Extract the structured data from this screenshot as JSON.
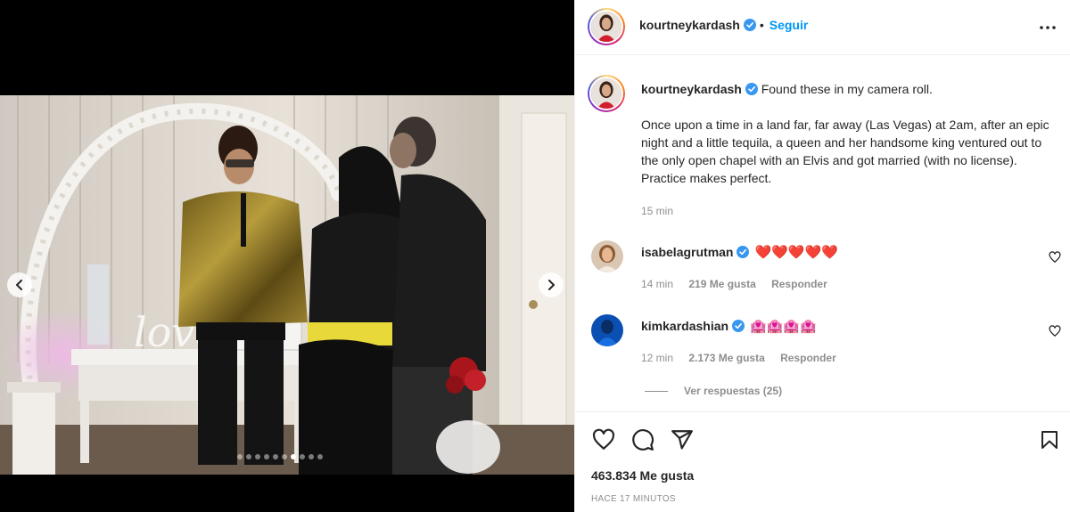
{
  "post": {
    "author": "kourtneykardash",
    "follow_label": "Seguir",
    "follow_separator": "•",
    "caption_lead": "Found these in my camera roll.",
    "caption_body": "Once upon a time in a land far, far away (Las Vegas) at 2am, after an epic night and a little tequila, a queen and her handsome king ventured out to the only open chapel with an Elvis and got married (with no license). Practice makes perfect.",
    "caption_time": "15 min",
    "likes": "463.834 Me gusta",
    "posted_ago": "HACE 17 MINUTOS"
  },
  "media": {
    "carousel_dots": 10,
    "active_dot": 6,
    "photo_sign_text": "love"
  },
  "comments": [
    {
      "user": "isabelagrutman",
      "text": "❤️❤️❤️❤️❤️",
      "time": "14 min",
      "likes": "219 Me gusta",
      "reply_label": "Responder"
    },
    {
      "user": "kimkardashian",
      "text": "🏩🏩🏩🏩",
      "time": "12 min",
      "likes": "2.173 Me gusta",
      "reply_label": "Responder"
    }
  ],
  "view_replies": "Ver respuestas (25)",
  "icons": {
    "verified": "verified-badge-icon",
    "more": "more-options-icon",
    "like": "heart-icon",
    "comment": "comment-icon",
    "share": "share-icon",
    "save": "bookmark-icon",
    "prev": "chevron-left-icon",
    "next": "chevron-right-icon"
  },
  "colors": {
    "accent": "#0095f6",
    "text": "#262626",
    "muted": "#8e8e8e",
    "verified": "#3897f0"
  }
}
